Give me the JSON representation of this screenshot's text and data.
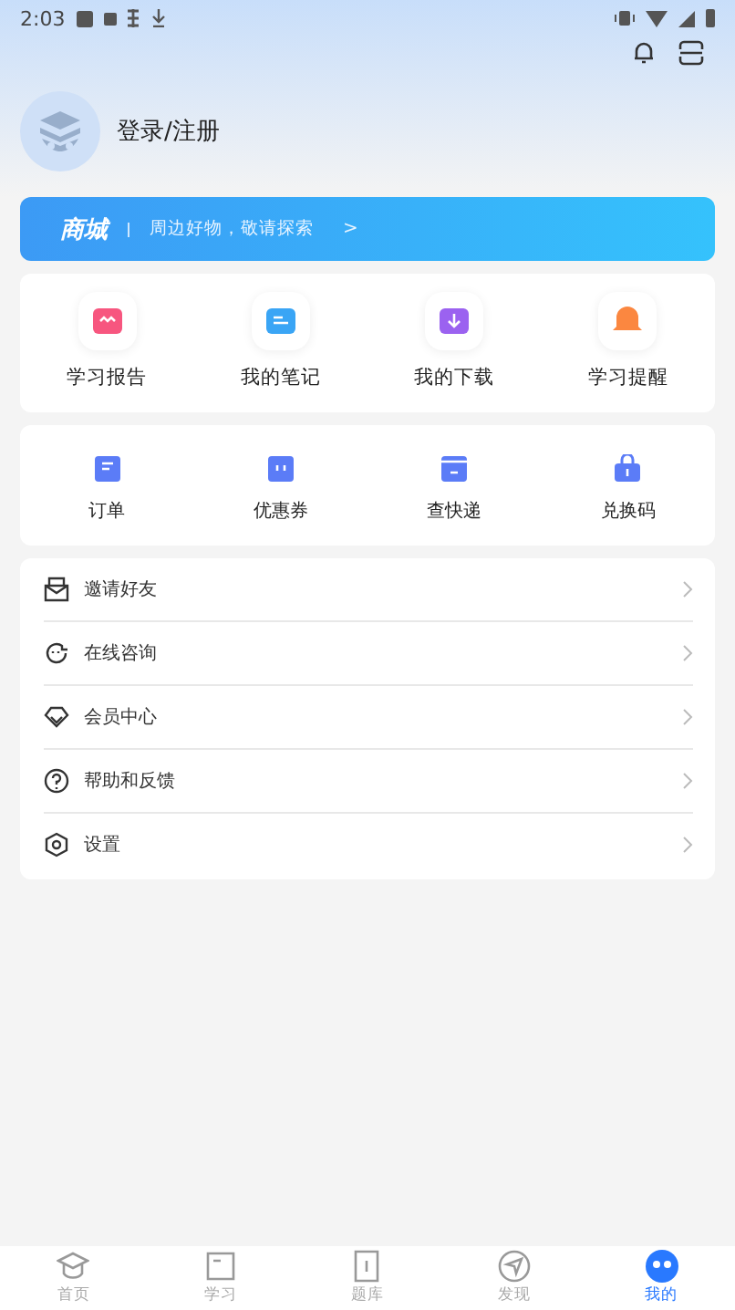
{
  "status_bar": {
    "time": "2:03"
  },
  "profile": {
    "login_label": "登录/注册"
  },
  "mall_banner": {
    "title": "商城",
    "subtitle": "周边好物，敬请探索",
    "arrow": ">"
  },
  "study_tools": [
    {
      "label": "学习报告",
      "color": "#f7567f"
    },
    {
      "label": "我的笔记",
      "color": "#3aa5f5"
    },
    {
      "label": "我的下载",
      "color": "#9b62f0"
    },
    {
      "label": "学习提醒",
      "color": "#fb8740"
    }
  ],
  "services": [
    {
      "label": "订单"
    },
    {
      "label": "优惠券"
    },
    {
      "label": "查快递"
    },
    {
      "label": "兑换码"
    }
  ],
  "menu": [
    {
      "label": "邀请好友"
    },
    {
      "label": "在线咨询"
    },
    {
      "label": "会员中心"
    },
    {
      "label": "帮助和反馈"
    },
    {
      "label": "设置"
    }
  ],
  "bottom_nav": [
    {
      "label": "首页",
      "selected": false
    },
    {
      "label": "学习",
      "selected": false
    },
    {
      "label": "题库",
      "selected": false
    },
    {
      "label": "发现",
      "selected": false
    },
    {
      "label": "我的",
      "selected": true
    }
  ]
}
